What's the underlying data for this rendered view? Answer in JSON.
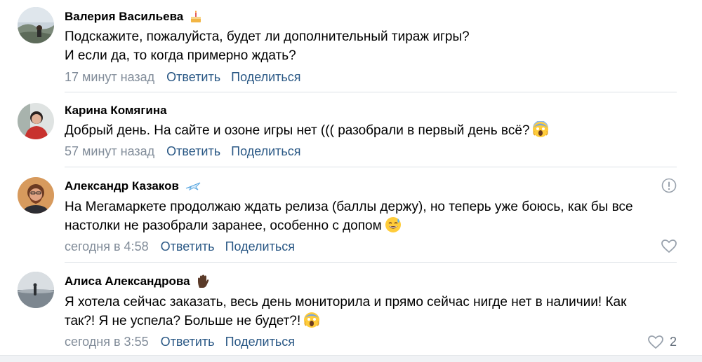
{
  "comments": [
    {
      "author": "Валерия Васильева",
      "badge": "cake-icon",
      "text_lines": [
        "Подскажите, пожалуйста, будет ли дополнительный тираж игры?",
        "И если да, то когда примерно ждать?"
      ],
      "time": "17 минут назад",
      "reply": "Ответить",
      "share": "Поделиться"
    },
    {
      "author": "Карина Комягина",
      "text_lines": [
        "Добрый день. На сайте и озоне игры нет ((( разобрали в первый день всё?"
      ],
      "emoji": "scream-emoji",
      "time": "57 минут назад",
      "reply": "Ответить",
      "share": "Поделиться"
    },
    {
      "author": "Александр Казаков",
      "badge": "plane-icon",
      "text_lines": [
        "На Мегамаркете продолжаю ждать релиза (баллы держу), но теперь уже боюсь, как бы все",
        "настолки не разобрали заранее, особенно с допом"
      ],
      "emoji": "sweat-smile-emoji",
      "time": "сегодня в 4:58",
      "reply": "Ответить",
      "share": "Поделиться"
    },
    {
      "author": "Алиса Александрова",
      "badge": "raised-hand-icon",
      "text_lines": [
        "Я хотела сейчас заказать, весь день мониторила и прямо сейчас нигде нет в наличии! Как",
        "так?! Я не успела? Больше не будет?!"
      ],
      "emoji": "scream-emoji",
      "time": "сегодня в 3:55",
      "reply": "Ответить",
      "share": "Поделиться",
      "likes": "2"
    }
  ],
  "colors": {
    "link": "#2a5885",
    "meta": "#818c99",
    "separator": "#dce1e6"
  }
}
